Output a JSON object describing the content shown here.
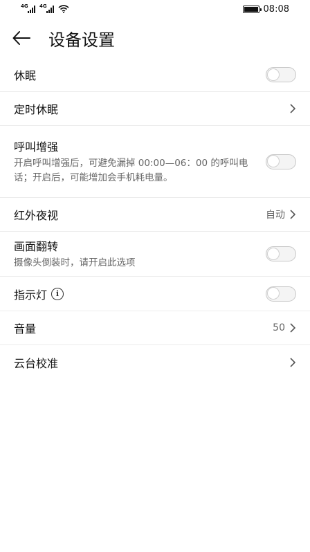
{
  "status_bar": {
    "sim1_tag": "4G",
    "sim2_tag": "4G",
    "time": "08:08",
    "icons": [
      "signal-icon",
      "signal-icon",
      "wifi-icon",
      "battery-icon"
    ]
  },
  "header": {
    "back_icon": "arrow-left-icon",
    "title": "设备设置"
  },
  "settings": {
    "sleep": {
      "label": "休眠",
      "toggle_on": false
    },
    "scheduled_sleep": {
      "label": "定时休眠"
    },
    "call_boost": {
      "label": "呼叫增强",
      "description": "开启呼叫增强后，可避免漏掉 00:00—06：00 的呼叫电话；开启后，可能增加会手机耗电量。",
      "toggle_on": false
    },
    "ir_night": {
      "label": "红外夜视",
      "value": "自动"
    },
    "flip": {
      "label": "画面翻转",
      "description": "摄像头倒装时，请开启此选项",
      "toggle_on": false
    },
    "indicator": {
      "label": "指示灯",
      "info_icon": "i",
      "toggle_on": false
    },
    "volume": {
      "label": "音量",
      "value": "50"
    },
    "ptz_calibration": {
      "label": "云台校准"
    }
  },
  "colors": {
    "divider": "#ececec",
    "text_primary": "#111111",
    "text_secondary": "#666666",
    "toggle_off": "#f4f4f4"
  }
}
